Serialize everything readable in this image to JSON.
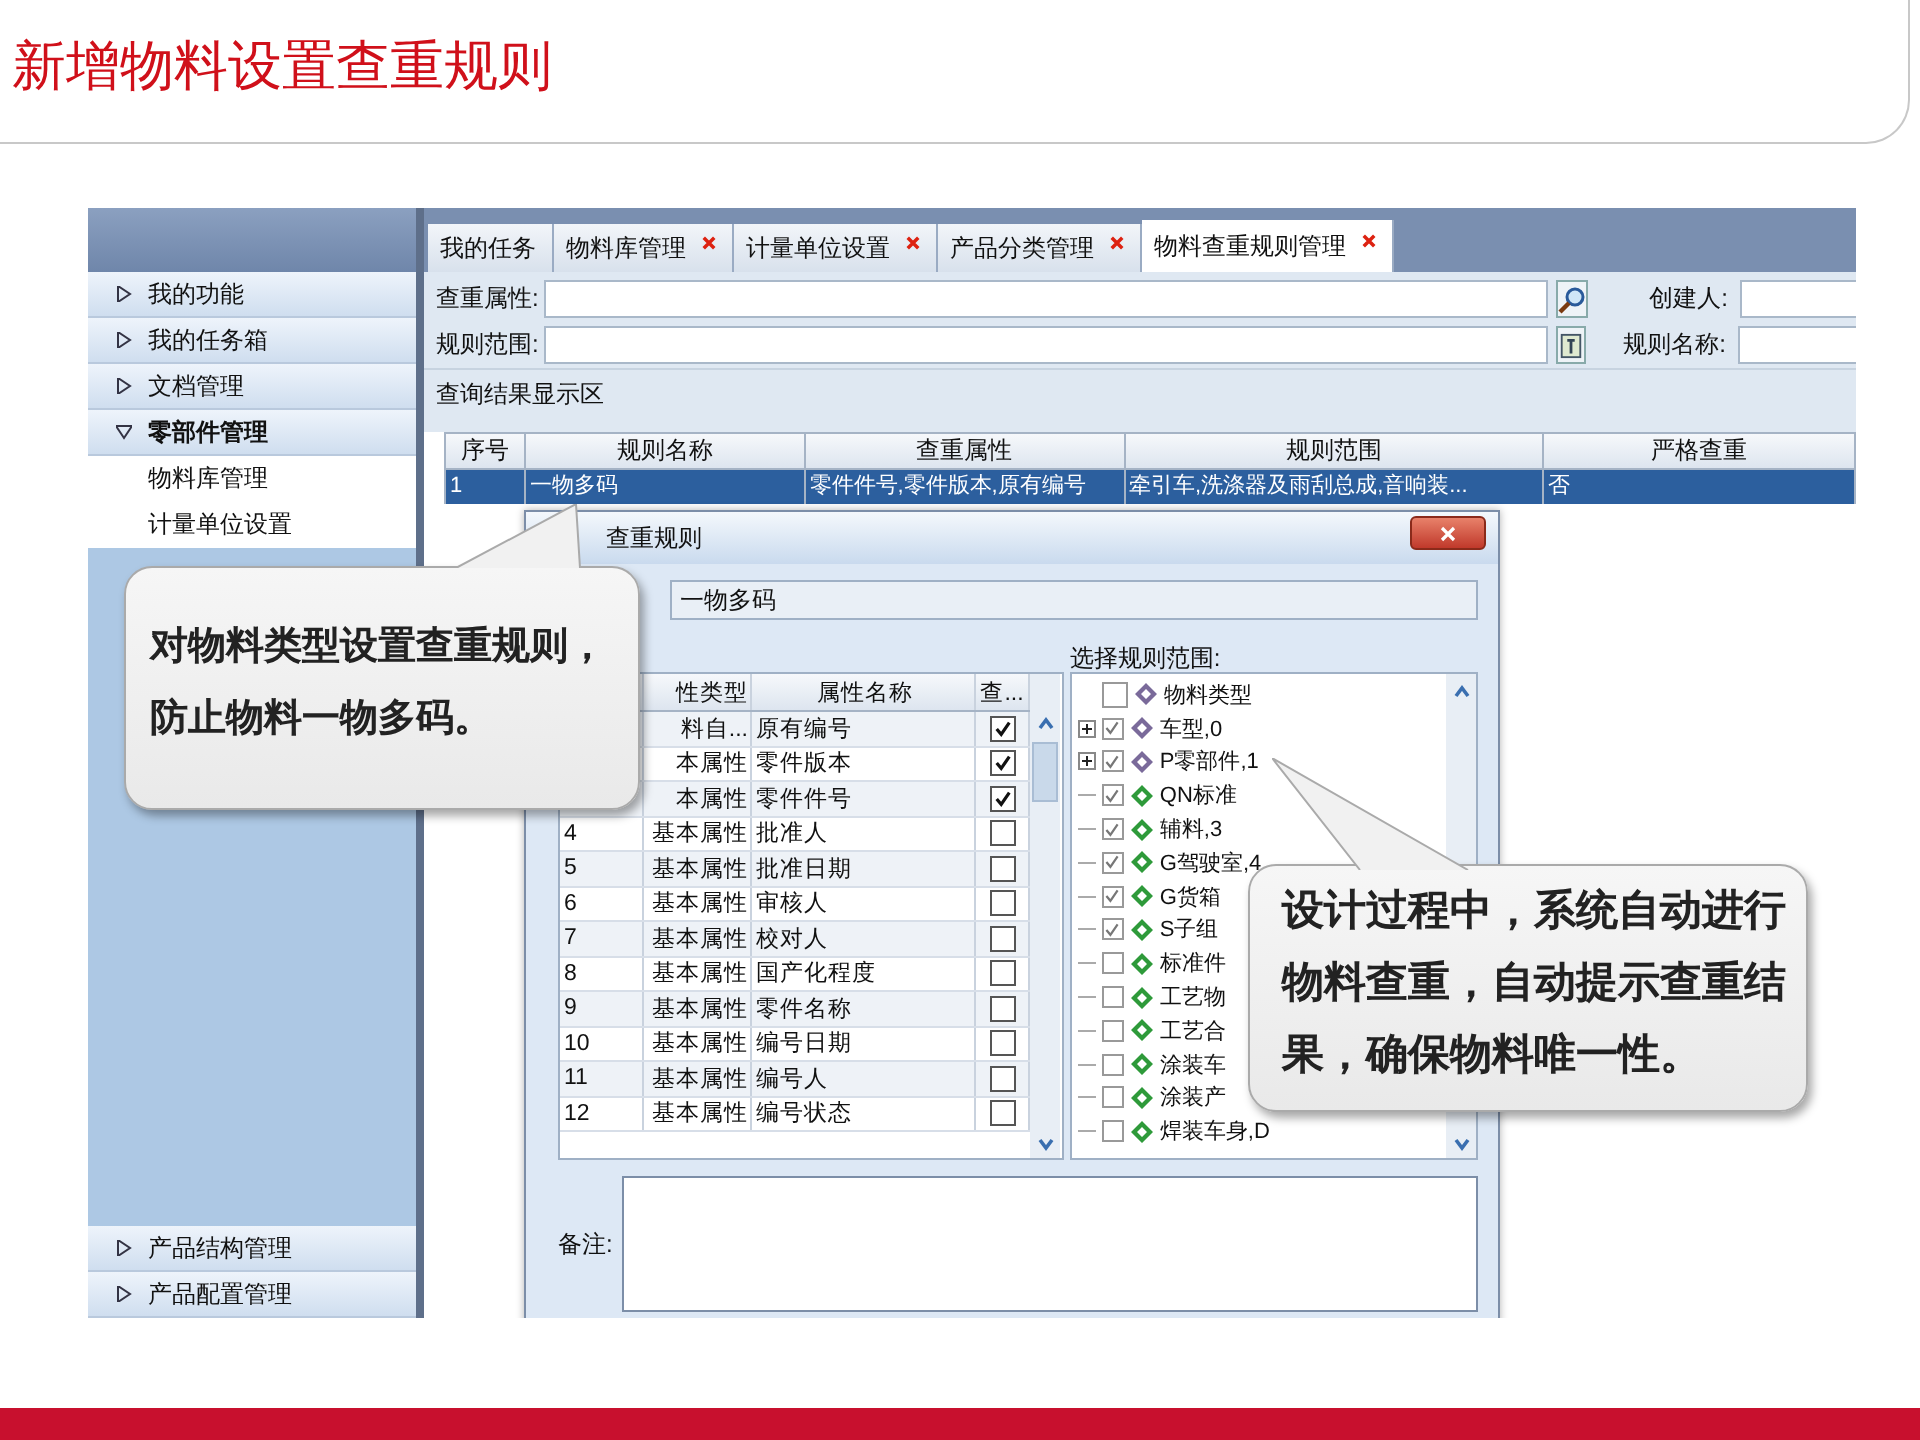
{
  "slide_title": "新增物料设置查重规则",
  "sidebar": {
    "items": [
      {
        "label": "我的功能",
        "expanded": false
      },
      {
        "label": "我的任务箱",
        "expanded": false
      },
      {
        "label": "文档管理",
        "expanded": false
      },
      {
        "label": "零部件管理",
        "expanded": true,
        "children": [
          {
            "label": "物料库管理"
          },
          {
            "label": "计量单位设置"
          }
        ]
      }
    ],
    "bottom_items": [
      {
        "label": "产品结构管理",
        "expanded": false
      },
      {
        "label": "产品配置管理",
        "expanded": false
      }
    ]
  },
  "tabs": [
    {
      "label": "我的任务",
      "closable": false,
      "selected": false
    },
    {
      "label": "物料库管理",
      "closable": true,
      "selected": false
    },
    {
      "label": "计量单位设置",
      "closable": true,
      "selected": false
    },
    {
      "label": "产品分类管理",
      "closable": true,
      "selected": false
    },
    {
      "label": "物料查重规则管理",
      "closable": true,
      "selected": true
    }
  ],
  "search_form": {
    "rows": [
      {
        "label": "查重属性:",
        "kind": "search",
        "right_label": "创建人:"
      },
      {
        "label": "规则范围:",
        "kind": "picker",
        "right_label": "规则名称:"
      }
    ]
  },
  "results": {
    "title": "查询结果显示区",
    "columns": [
      "序号",
      "规则名称",
      "查重属性",
      "规则范围",
      "严格查重"
    ],
    "rows": [
      {
        "selected": true,
        "cells": [
          "1",
          "一物多码",
          "零件件号,零件版本,原有编号",
          "牵引车,洗涤器及雨刮总成,音响装...",
          "否"
        ]
      }
    ]
  },
  "dialog": {
    "title": "查重规则",
    "name_value": "一物多码",
    "attributes": {
      "columns": [
        "性类型",
        "属性名称",
        "查..."
      ],
      "rows": [
        {
          "type": "料自...",
          "name": "原有编号",
          "checked": true
        },
        {
          "type": "本属性",
          "name": "零件版本",
          "checked": true
        },
        {
          "type": "本属性",
          "name": "零件件号",
          "checked": true
        },
        {
          "index": "4",
          "type": "基本属性",
          "name": "批准人",
          "checked": false
        },
        {
          "index": "5",
          "type": "基本属性",
          "name": "批准日期",
          "checked": false
        },
        {
          "index": "6",
          "type": "基本属性",
          "name": "审核人",
          "checked": false
        },
        {
          "index": "7",
          "type": "基本属性",
          "name": "校对人",
          "checked": false
        },
        {
          "index": "8",
          "type": "基本属性",
          "name": "国产化程度",
          "checked": false
        },
        {
          "index": "9",
          "type": "基本属性",
          "name": "零件名称",
          "checked": false
        },
        {
          "index": "10",
          "type": "基本属性",
          "name": "编号日期",
          "checked": false
        },
        {
          "index": "11",
          "type": "基本属性",
          "name": "编号人",
          "checked": false
        },
        {
          "index": "12",
          "type": "基本属性",
          "name": "编号状态",
          "checked": false
        }
      ]
    },
    "scope": {
      "label": "选择规则范围:",
      "tree": [
        {
          "label": "物料类型",
          "checked": false,
          "expandable": false,
          "color": "#7a6a9a"
        },
        {
          "label": "车型,0",
          "checked": true,
          "expandable": true,
          "color": "#7a6a9a"
        },
        {
          "label": "P零部件,1",
          "checked": true,
          "expandable": true,
          "color": "#7a6a9a"
        },
        {
          "label": "QN标准",
          "checked": true,
          "expandable": false,
          "color": "#2e9a3a"
        },
        {
          "label": "辅料,3",
          "checked": true,
          "expandable": false,
          "color": "#2e9a3a"
        },
        {
          "label": "G驾驶室,4",
          "checked": true,
          "expandable": false,
          "color": "#2e9a3a"
        },
        {
          "label": "G货箱",
          "checked": true,
          "expandable": false,
          "color": "#2e9a3a"
        },
        {
          "label": "S子组",
          "checked": true,
          "expandable": false,
          "color": "#2e9a3a"
        },
        {
          "label": "标准件",
          "checked": false,
          "expandable": false,
          "color": "#2e9a3a"
        },
        {
          "label": "工艺物",
          "checked": false,
          "expandable": false,
          "color": "#2e9a3a"
        },
        {
          "label": "工艺合",
          "checked": false,
          "expandable": false,
          "color": "#2e9a3a"
        },
        {
          "label": "涂装车",
          "checked": false,
          "expandable": false,
          "color": "#2e9a3a"
        },
        {
          "label": "涂装产",
          "checked": false,
          "expandable": false,
          "color": "#2e9a3a"
        },
        {
          "label": "焊装车身,D",
          "checked": false,
          "expandable": false,
          "color": "#2e9a3a"
        }
      ]
    },
    "remark_label": "备注:"
  },
  "callouts": [
    {
      "text": "对物料类型设置查重规则，防止物料一物多码。"
    },
    {
      "text": "设计过程中，系统自动进行物料查重，自动提示查重结果，确保物料唯一性。"
    }
  ]
}
